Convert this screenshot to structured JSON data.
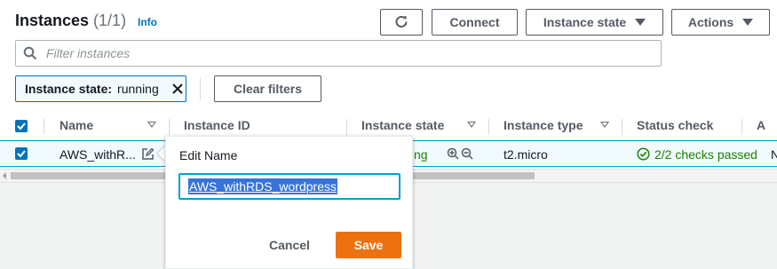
{
  "header": {
    "title": "Instances",
    "count": "(1/1)",
    "info_link": "Info",
    "connect_label": "Connect",
    "instance_state_label": "Instance state",
    "actions_label": "Actions"
  },
  "filter": {
    "placeholder": "Filter instances",
    "token_key": "Instance state:",
    "token_value": "running",
    "clear_label": "Clear filters"
  },
  "table": {
    "columns": [
      "Name",
      "Instance ID",
      "Instance state",
      "Instance type",
      "Status check",
      "A"
    ],
    "row": {
      "name": "AWS_withR...",
      "state_fragment": "ng",
      "type": "t2.micro",
      "status": "2/2 checks passed",
      "next_fragment": "N"
    }
  },
  "edit_popover": {
    "label": "Edit Name",
    "value": "AWS_withRDS_wordpress",
    "cancel_label": "Cancel",
    "save_label": "Save"
  },
  "colors": {
    "accent": "#0073bb",
    "primary_button": "#ec7211",
    "success": "#1d8102"
  }
}
